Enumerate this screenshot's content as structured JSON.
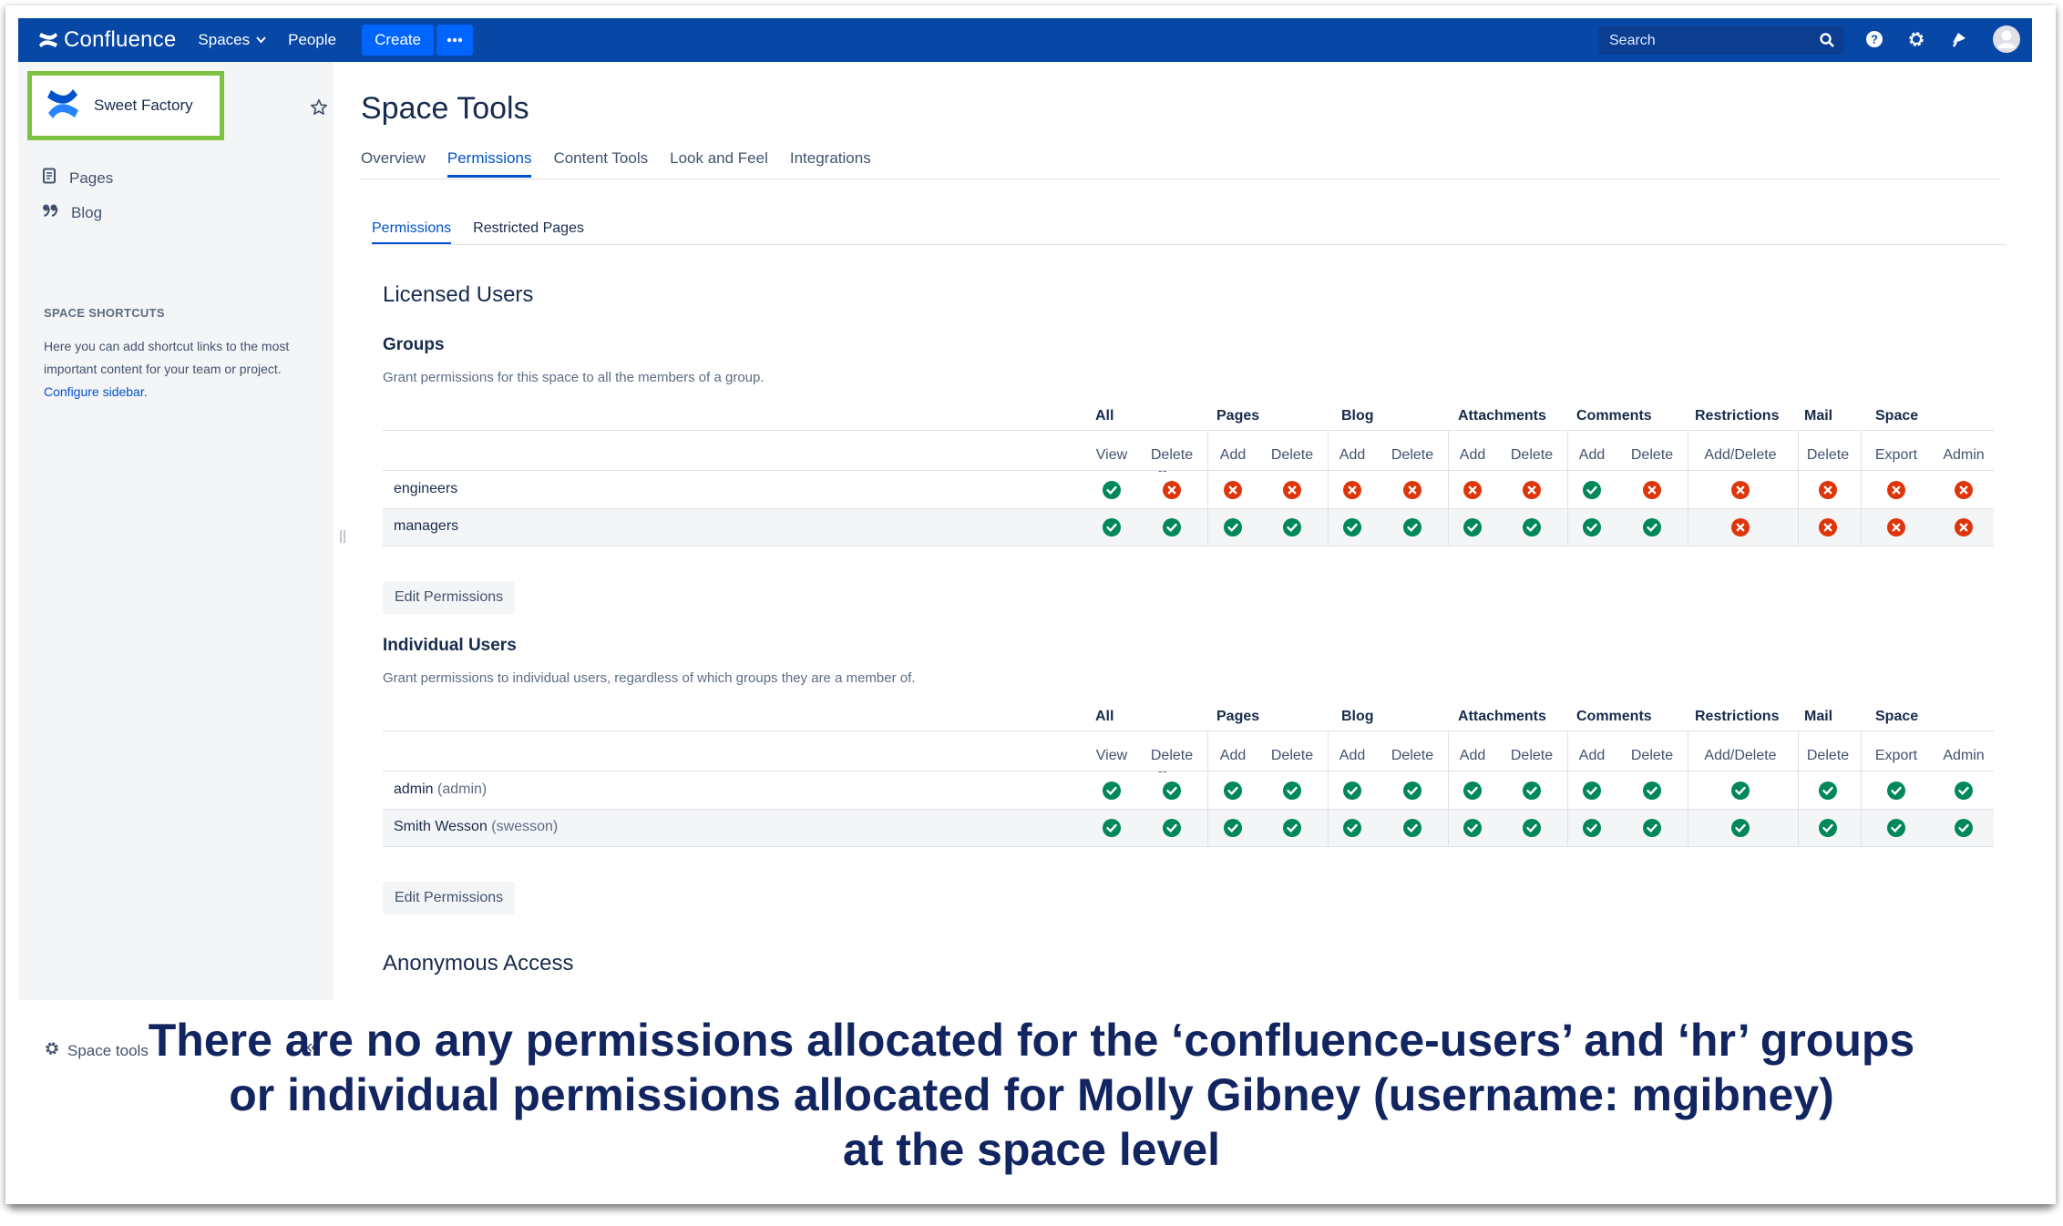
{
  "nav": {
    "logo_text": "Confluence",
    "spaces_label": "Spaces",
    "people_label": "People",
    "create_label": "Create",
    "more_label": "•••",
    "search_placeholder": "Search",
    "icons": [
      "confluence-logo-icon",
      "chevron-down-icon",
      "search-icon",
      "help-icon",
      "gear-icon",
      "notifications-icon",
      "avatar-icon"
    ],
    "bar_color": "#0747a6",
    "create_color": "#0065ff"
  },
  "sidebar": {
    "space_name": "Sweet Factory",
    "highlight_color": "#7dc242",
    "items": [
      {
        "label": "Pages",
        "icon": "page-icon"
      },
      {
        "label": "Blog",
        "icon": "quote-icon"
      }
    ],
    "shortcuts_title": "SPACE SHORTCUTS",
    "shortcuts_text": "Here you can add shortcut links to the most important content for your team or project.",
    "shortcuts_link": "Configure sidebar.",
    "space_tools_label": "Space tools",
    "collapse_label": "«"
  },
  "main": {
    "title": "Space Tools",
    "tabs": [
      "Overview",
      "Permissions",
      "Content Tools",
      "Look and Feel",
      "Integrations"
    ],
    "active_tab": "Permissions",
    "subtabs": [
      "Permissions",
      "Restricted Pages"
    ],
    "active_subtab": "Permissions",
    "licensed_heading": "Licensed Users",
    "groups_heading": "Groups",
    "groups_desc": "Grant permissions for this space to all the members of a group.",
    "individuals_heading": "Individual Users",
    "individuals_desc": "Grant permissions to individual users, regardless of which groups they are a member of.",
    "edit_button_label": "Edit Permissions",
    "anonymous_heading": "Anonymous Access"
  },
  "permissions": {
    "categories": [
      {
        "name": "All",
        "columns": [
          "View",
          "Delete Own"
        ]
      },
      {
        "name": "Pages",
        "columns": [
          "Add",
          "Delete"
        ]
      },
      {
        "name": "Blog",
        "columns": [
          "Add",
          "Delete"
        ]
      },
      {
        "name": "Attachments",
        "columns": [
          "Add",
          "Delete"
        ]
      },
      {
        "name": "Comments",
        "columns": [
          "Add",
          "Delete"
        ]
      },
      {
        "name": "Restrictions",
        "columns": [
          "Add/Delete"
        ]
      },
      {
        "name": "Mail",
        "columns": [
          "Delete"
        ]
      },
      {
        "name": "Space",
        "columns": [
          "Export",
          "Admin"
        ]
      }
    ],
    "groups": [
      {
        "name": "engineers",
        "username": "",
        "values": [
          true,
          false,
          false,
          false,
          false,
          false,
          false,
          false,
          true,
          false,
          false,
          false,
          false,
          false
        ]
      },
      {
        "name": "managers",
        "username": "",
        "values": [
          true,
          true,
          true,
          true,
          true,
          true,
          true,
          true,
          true,
          true,
          false,
          false,
          false,
          false
        ]
      }
    ],
    "individuals": [
      {
        "name": "admin",
        "username": "(admin)",
        "values": [
          true,
          true,
          true,
          true,
          true,
          true,
          true,
          true,
          true,
          true,
          true,
          true,
          true,
          true
        ]
      },
      {
        "name": "Smith Wesson",
        "username": "(swesson)",
        "values": [
          true,
          true,
          true,
          true,
          true,
          true,
          true,
          true,
          true,
          true,
          true,
          true,
          true,
          true
        ]
      }
    ],
    "granted_color": "#00875a",
    "denied_color": "#de350b"
  },
  "caption": {
    "lines": [
      "There are no any permissions allocated for the ‘confluence-users’ and ‘hr’ groups",
      "or individual permissions allocated for Molly Gibney (username: mgibney)",
      "at the space level"
    ],
    "color": "#122561"
  }
}
